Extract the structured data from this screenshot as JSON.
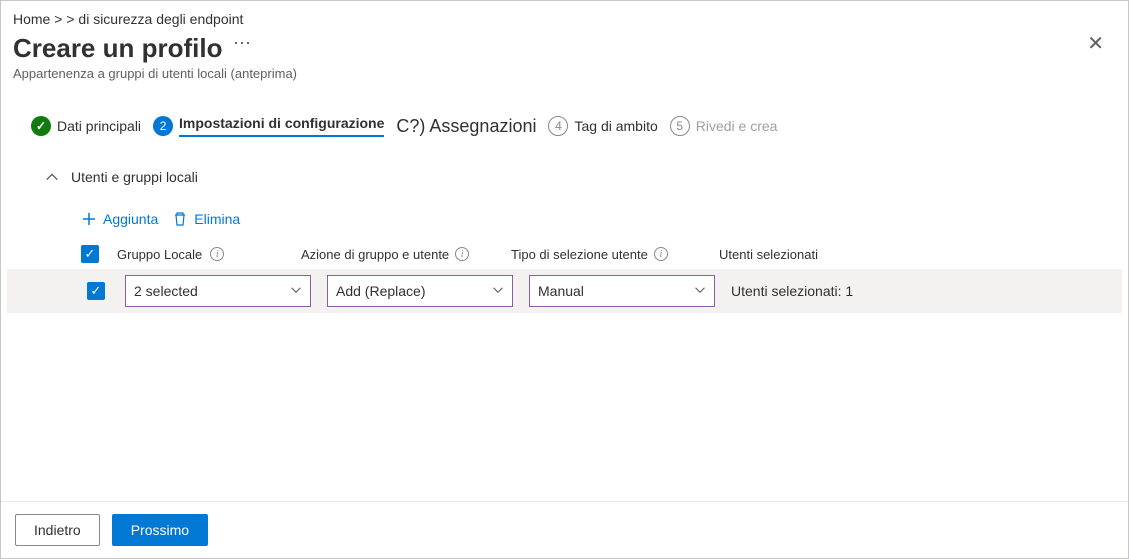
{
  "breadcrumb": {
    "home": "Home",
    "current": "di sicurezza degli endpoint"
  },
  "header": {
    "title": "Creare un profilo",
    "subtitle": "Appartenenza a gruppi di utenti locali (anteprima)"
  },
  "steps": [
    {
      "label": "Dati principali"
    },
    {
      "num": "2",
      "label": "Impostazioni di configurazione"
    },
    {
      "label": "C?) Assegnazioni"
    },
    {
      "num": "4",
      "label": "Tag di ambito"
    },
    {
      "num": "5",
      "label": "Rivedi e crea"
    }
  ],
  "section": {
    "title": "Utenti e gruppi locali"
  },
  "toolbar": {
    "add": "Aggiunta",
    "delete": "Elimina"
  },
  "columns": {
    "localGroup": "Gruppo Locale",
    "groupUserAction": "Azione di gruppo e utente",
    "userSelectionType": "Tipo di selezione utente",
    "selectedUsers": "Utenti selezionati"
  },
  "row": {
    "localGroup": "2 selected",
    "action": "Add (Replace)",
    "selectionType": "Manual",
    "selectedUsers": "Utenti selezionati: 1"
  },
  "footer": {
    "back": "Indietro",
    "next": "Prossimo"
  }
}
